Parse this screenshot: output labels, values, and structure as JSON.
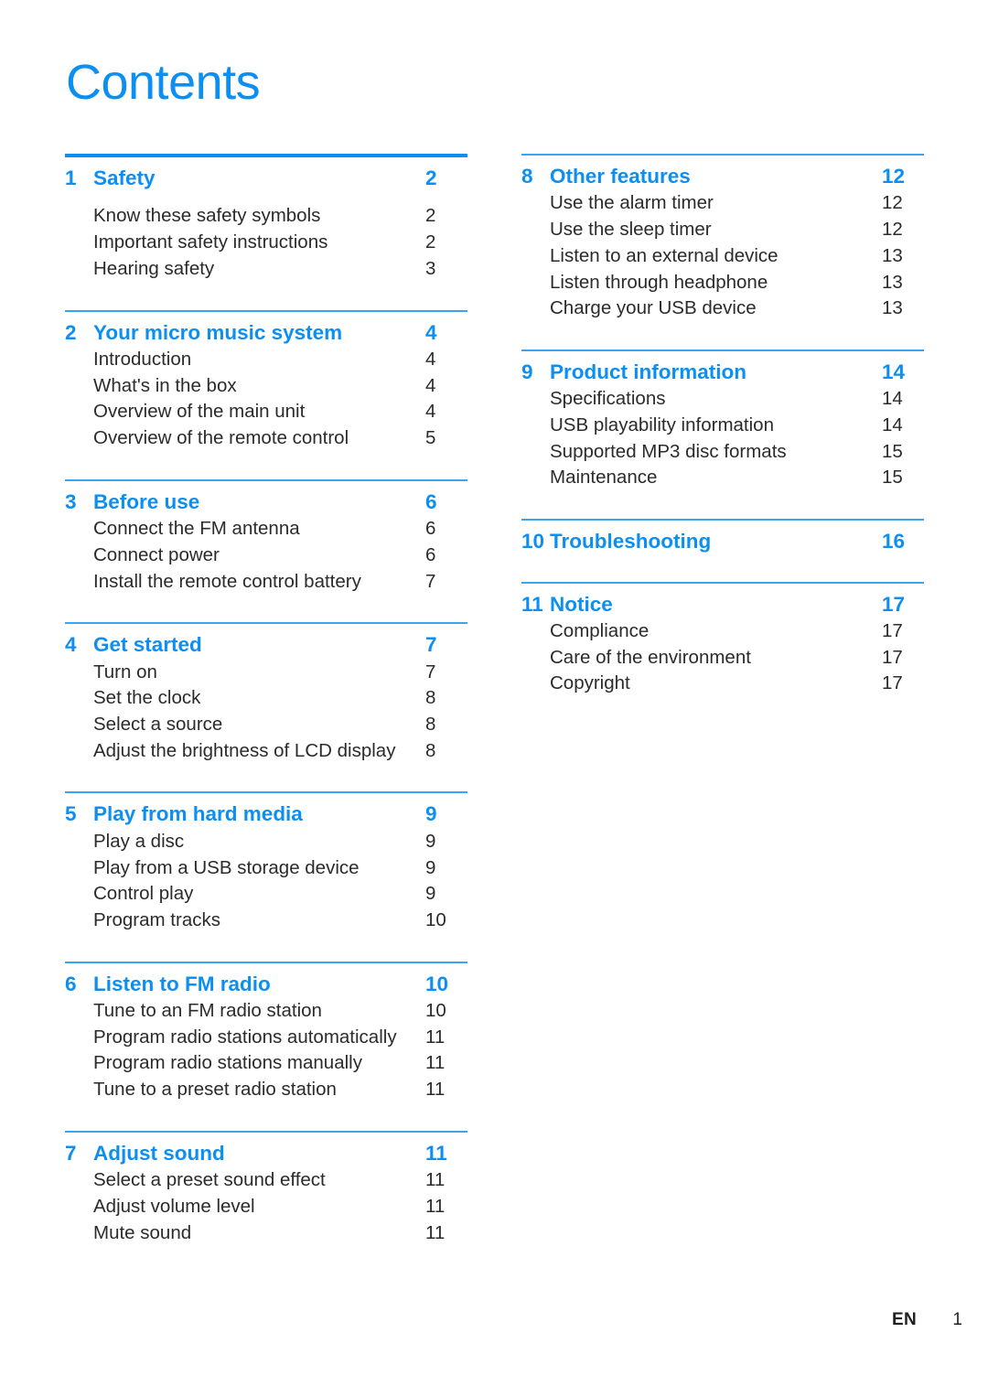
{
  "document": {
    "title": "Contents",
    "accent_color": "#0d8ff2",
    "rule_color": "#3aa4f0",
    "body_text_color": "#2b2b2b"
  },
  "footer": {
    "language": "EN",
    "page_number": "1"
  },
  "columns": {
    "left": [
      {
        "number": "1",
        "title": "Safety",
        "page": "2",
        "rule": "thick",
        "spaced_sub_list": true,
        "items": [
          {
            "label": "Know these safety symbols",
            "page": "2"
          },
          {
            "label": "Important safety instructions",
            "page": "2"
          },
          {
            "label": "Hearing safety",
            "page": "3"
          }
        ]
      },
      {
        "number": "2",
        "title": "Your micro music system",
        "page": "4",
        "rule": "thin",
        "spaced_sub_list": false,
        "items": [
          {
            "label": "Introduction",
            "page": "4"
          },
          {
            "label": "What's in the box",
            "page": "4"
          },
          {
            "label": "Overview of the main unit",
            "page": "4"
          },
          {
            "label": "Overview of the remote control",
            "page": "5"
          }
        ]
      },
      {
        "number": "3",
        "title": "Before use",
        "page": "6",
        "rule": "thin",
        "spaced_sub_list": false,
        "items": [
          {
            "label": "Connect the FM antenna",
            "page": "6"
          },
          {
            "label": "Connect power",
            "page": "6"
          },
          {
            "label": "Install the remote control battery",
            "page": "7"
          }
        ]
      },
      {
        "number": "4",
        "title": "Get started",
        "page": "7",
        "rule": "thin",
        "spaced_sub_list": false,
        "items": [
          {
            "label": "Turn on",
            "page": "7"
          },
          {
            "label": "Set the clock",
            "page": "8"
          },
          {
            "label": "Select a source",
            "page": "8"
          },
          {
            "label": "Adjust the brightness of LCD display",
            "page": "8"
          }
        ]
      },
      {
        "number": "5",
        "title": "Play from hard media",
        "page": "9",
        "rule": "thin",
        "spaced_sub_list": false,
        "items": [
          {
            "label": "Play a disc",
            "page": "9"
          },
          {
            "label": "Play from a USB storage device",
            "page": "9"
          },
          {
            "label": "Control play",
            "page": "9"
          },
          {
            "label": "Program tracks",
            "page": "10"
          }
        ]
      },
      {
        "number": "6",
        "title": "Listen to FM radio",
        "page": "10",
        "rule": "thin",
        "spaced_sub_list": false,
        "items": [
          {
            "label": "Tune to an FM radio station",
            "page": "10"
          },
          {
            "label": "Program radio stations automatically",
            "page": "11"
          },
          {
            "label": "Program radio stations manually",
            "page": "11"
          },
          {
            "label": "Tune to a preset radio station",
            "page": "11"
          }
        ]
      },
      {
        "number": "7",
        "title": "Adjust sound",
        "page": "11",
        "rule": "thin",
        "spaced_sub_list": false,
        "items": [
          {
            "label": "Select a preset sound effect",
            "page": "11"
          },
          {
            "label": "Adjust volume level",
            "page": "11"
          },
          {
            "label": "Mute sound",
            "page": "11"
          }
        ]
      }
    ],
    "right": [
      {
        "number": "8",
        "title": "Other features",
        "page": "12",
        "rule": "thin",
        "spaced_sub_list": false,
        "items": [
          {
            "label": "Use the alarm timer",
            "page": "12"
          },
          {
            "label": "Use the sleep timer",
            "page": "12"
          },
          {
            "label": "Listen to an external device",
            "page": "13"
          },
          {
            "label": "Listen through headphone",
            "page": "13"
          },
          {
            "label": "Charge your USB device",
            "page": "13"
          }
        ]
      },
      {
        "number": "9",
        "title": "Product information",
        "page": "14",
        "rule": "thin",
        "spaced_sub_list": false,
        "items": [
          {
            "label": "Specifications",
            "page": "14"
          },
          {
            "label": "USB playability information",
            "page": "14"
          },
          {
            "label": "Supported MP3 disc formats",
            "page": "15"
          },
          {
            "label": "Maintenance",
            "page": "15"
          }
        ]
      },
      {
        "number": "10",
        "title": "Troubleshooting",
        "page": "16",
        "rule": "thin",
        "spaced_sub_list": false,
        "items": []
      },
      {
        "number": "11",
        "title": "Notice",
        "page": "17",
        "rule": "thin",
        "spaced_sub_list": false,
        "items": [
          {
            "label": "Compliance",
            "page": "17"
          },
          {
            "label": "Care of the environment",
            "page": "17"
          },
          {
            "label": "Copyright",
            "page": "17"
          }
        ]
      }
    ]
  }
}
